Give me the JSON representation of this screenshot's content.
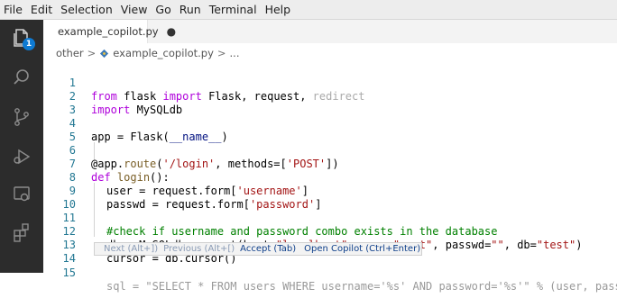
{
  "menu": [
    "File",
    "Edit",
    "Selection",
    "View",
    "Go",
    "Run",
    "Terminal",
    "Help"
  ],
  "activity": {
    "badge": "1"
  },
  "tab": {
    "filename": "example_copilot.py",
    "modified_indicator": "●"
  },
  "breadcrumb": {
    "folder": "other",
    "separator": ">",
    "file": "example_copilot.py",
    "trail": "..."
  },
  "lines": [
    {
      "n": "1"
    },
    {
      "n": "2"
    },
    {
      "n": "3"
    },
    {
      "n": "4"
    },
    {
      "n": "5"
    },
    {
      "n": "6"
    },
    {
      "n": "7"
    },
    {
      "n": "8"
    },
    {
      "n": "9"
    },
    {
      "n": "10"
    },
    {
      "n": "11"
    },
    {
      "n": "12"
    },
    {
      "n": "13"
    },
    {
      "n": "14"
    },
    {
      "n": "15"
    }
  ],
  "code": {
    "l1": {
      "kw1": "from",
      "t1": " flask ",
      "kw2": "import",
      "t2": " Flask, request, ",
      "dim": "redirect"
    },
    "l2": {
      "kw": "import",
      "t": " MySQLdb"
    },
    "l4": {
      "t1": "app = Flask(",
      "param": "__name__",
      "t2": ")"
    },
    "l6": {
      "t1": "@app.",
      "fn": "route",
      "t2": "(",
      "s1": "'/login'",
      "t3": ", methods=[",
      "s2": "'POST'",
      "t4": "])"
    },
    "l7": {
      "kw": "def",
      "sp": " ",
      "fn": "login",
      "t": "():"
    },
    "l8": {
      "t1": "user = request.form[",
      "s": "'username'",
      "t2": "]"
    },
    "l9": {
      "t1": "passwd = request.form[",
      "s": "'password'",
      "t2": "]"
    },
    "l11": {
      "c": "#check if username and password combo exists in the database"
    },
    "l12": {
      "t1": "db = MySQLdb.connect(host=",
      "s1": "\"localhost\"",
      "t2": ", user=",
      "s2": "\"root\"",
      "t3": ", passwd=",
      "s3": "\"\"",
      "t4": ", db=",
      "s4": "\"test\"",
      "t5": ")"
    },
    "l13": {
      "t": "cursor = db.cursor()"
    },
    "l15": {
      "t": "sql = \"SELECT * FROM users WHERE username='%s' AND password='%s'\" % (user, passwd)"
    }
  },
  "copilot": {
    "next": "Next (Alt+])",
    "previous": "Previous (Alt+[)",
    "accept": "Accept (Tab)",
    "open": "Open Copilot (Ctrl+Enter)"
  },
  "colors": {
    "activity_bg": "#2c2c2c",
    "badge": "#0e7ad2",
    "keyword": "#af00db",
    "string": "#a31515",
    "comment": "#008000",
    "line_number": "#237893"
  }
}
